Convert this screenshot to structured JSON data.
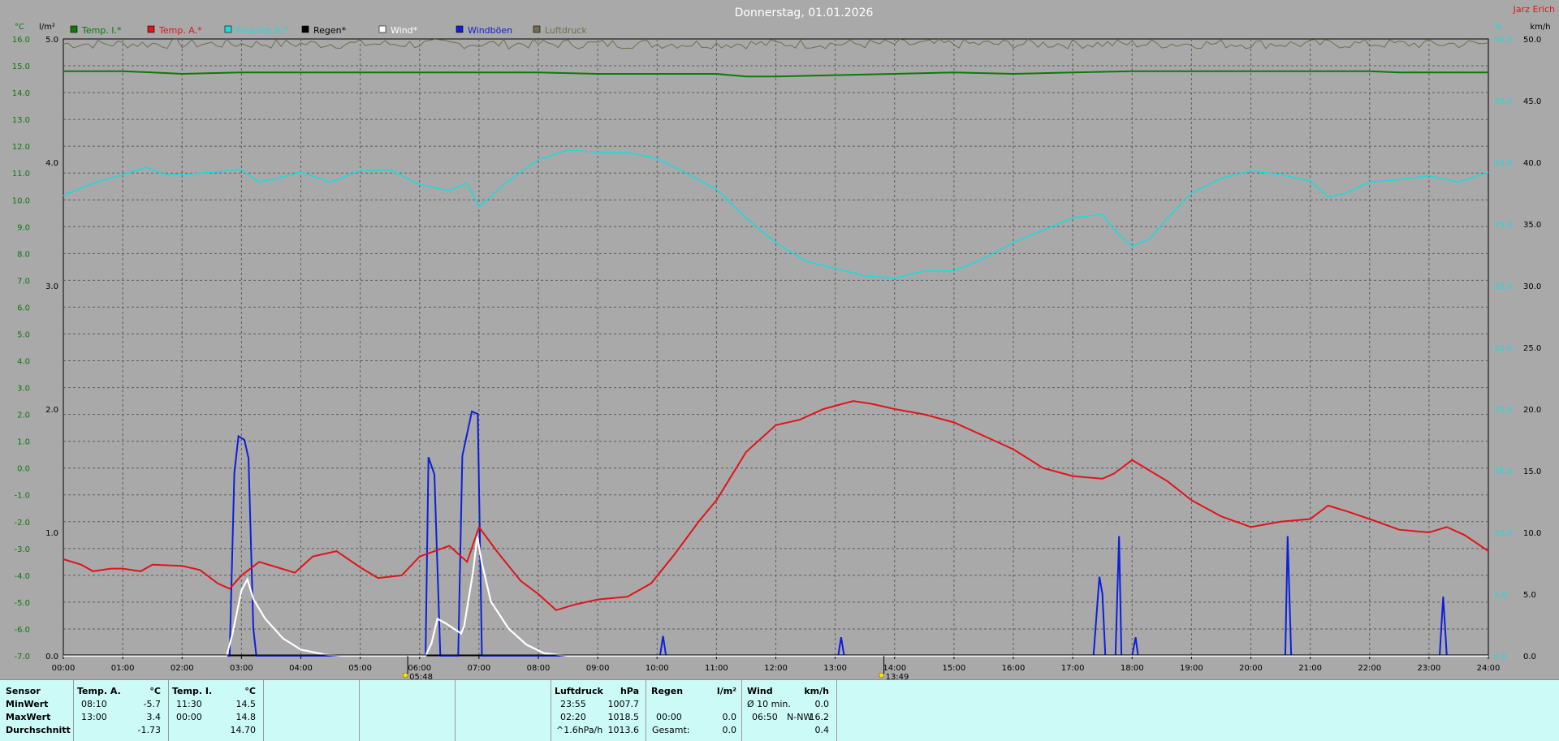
{
  "title": "Donnerstag, 01.01.2026",
  "author": "Jarz Erich",
  "colors": {
    "background": "#a9a9a9",
    "temp_inside": "#0a7a0a",
    "temp_outside": "#e0141a",
    "humidity": "#1fd9dc",
    "rain": "#000000",
    "wind": "#ffffff",
    "gusts": "#0c1fdc",
    "pressure": "#6f6f4e",
    "axis_right": "#1fd9dc",
    "footer_bg": "#ccfbf7"
  },
  "chart_data": {
    "type": "line",
    "axis_units": {
      "left_temp": "°C",
      "left_rain": "l/m²",
      "right_humidity": "%",
      "right_wind": "km/h"
    },
    "legend": [
      {
        "name": "Temp. I.*",
        "color": "#0a7a0a"
      },
      {
        "name": "Temp. A.*",
        "color": "#e0141a"
      },
      {
        "name": "Feuchte A.*",
        "color": "#1fd9dc"
      },
      {
        "name": "Regen*",
        "color": "#000000"
      },
      {
        "name": "Wind*",
        "color": "#ffffff"
      },
      {
        "name": "Windböen",
        "color": "#0c1fdc"
      },
      {
        "name": "Luftdruck",
        "color": "#6f6f4e"
      }
    ],
    "x_ticks": [
      "00:00",
      "01:00",
      "02:00",
      "03:00",
      "04:00",
      "05:00",
      "06:00",
      "07:00",
      "08:00",
      "09:00",
      "10:00",
      "11:00",
      "12:00",
      "13:00",
      "14:00",
      "15:00",
      "16:00",
      "17:00",
      "18:00",
      "19:00",
      "20:00",
      "21:00",
      "22:00",
      "23:00",
      "24:00"
    ],
    "temp_ticks": [
      "-7.0",
      "-6.0",
      "-5.0",
      "-4.0",
      "-3.0",
      "-2.0",
      "-1.0",
      "0.0",
      "1.0",
      "2.0",
      "3.0",
      "4.0",
      "5.0",
      "6.0",
      "7.0",
      "8.0",
      "9.0",
      "10.0",
      "11.0",
      "12.0",
      "13.0",
      "14.0",
      "15.0",
      "16.0"
    ],
    "rain_ticks": [
      "0.0",
      "1.0",
      "2.0",
      "3.0",
      "4.0",
      "5.0"
    ],
    "wind_ticks": [
      "0.0",
      "5.0",
      "10.0",
      "15.0",
      "20.0",
      "25.0",
      "30.0",
      "35.0",
      "40.0",
      "45.0",
      "50.0"
    ],
    "temp_range": [
      -7,
      16
    ],
    "rain_range": [
      0,
      5
    ],
    "wind_range": [
      0,
      50
    ],
    "sunrise": "05:48",
    "sunset": "13:49",
    "sunrise_hour": 5.8,
    "sunset_hour": 13.82,
    "temp_inside": [
      [
        0,
        14.8
      ],
      [
        1,
        14.8
      ],
      [
        1.5,
        14.75
      ],
      [
        2,
        14.7
      ],
      [
        3,
        14.75
      ],
      [
        4,
        14.75
      ],
      [
        5,
        14.75
      ],
      [
        6,
        14.75
      ],
      [
        7,
        14.75
      ],
      [
        8,
        14.75
      ],
      [
        9,
        14.7
      ],
      [
        10,
        14.7
      ],
      [
        11,
        14.7
      ],
      [
        11.5,
        14.6
      ],
      [
        12,
        14.6
      ],
      [
        13,
        14.65
      ],
      [
        14,
        14.7
      ],
      [
        15,
        14.75
      ],
      [
        16,
        14.7
      ],
      [
        17,
        14.75
      ],
      [
        18,
        14.8
      ],
      [
        19,
        14.8
      ],
      [
        20,
        14.8
      ],
      [
        21,
        14.8
      ],
      [
        22,
        14.8
      ],
      [
        22.5,
        14.75
      ],
      [
        23,
        14.75
      ],
      [
        24,
        14.75
      ]
    ],
    "temp_outside": [
      [
        0,
        -3.4
      ],
      [
        0.3,
        -3.6
      ],
      [
        0.5,
        -3.85
      ],
      [
        0.8,
        -3.75
      ],
      [
        1,
        -3.75
      ],
      [
        1.3,
        -3.85
      ],
      [
        1.5,
        -3.6
      ],
      [
        2,
        -3.65
      ],
      [
        2.3,
        -3.8
      ],
      [
        2.6,
        -4.3
      ],
      [
        2.8,
        -4.5
      ],
      [
        3,
        -4.0
      ],
      [
        3.3,
        -3.5
      ],
      [
        3.6,
        -3.7
      ],
      [
        3.9,
        -3.9
      ],
      [
        4.2,
        -3.3
      ],
      [
        4.6,
        -3.1
      ],
      [
        5,
        -3.7
      ],
      [
        5.3,
        -4.1
      ],
      [
        5.7,
        -4.0
      ],
      [
        6,
        -3.3
      ],
      [
        6.5,
        -2.9
      ],
      [
        6.8,
        -3.5
      ],
      [
        7,
        -2.2
      ],
      [
        7.3,
        -3.1
      ],
      [
        7.7,
        -4.2
      ],
      [
        8,
        -4.7
      ],
      [
        8.3,
        -5.3
      ],
      [
        8.6,
        -5.1
      ],
      [
        9,
        -4.9
      ],
      [
        9.5,
        -4.8
      ],
      [
        9.9,
        -4.3
      ],
      [
        10.3,
        -3.2
      ],
      [
        10.7,
        -2.0
      ],
      [
        11,
        -1.2
      ],
      [
        11.5,
        0.6
      ],
      [
        12,
        1.6
      ],
      [
        12.4,
        1.8
      ],
      [
        12.8,
        2.2
      ],
      [
        13.3,
        2.5
      ],
      [
        13.6,
        2.4
      ],
      [
        14,
        2.2
      ],
      [
        14.5,
        2.0
      ],
      [
        15,
        1.7
      ],
      [
        15.5,
        1.2
      ],
      [
        16,
        0.7
      ],
      [
        16.5,
        0.0
      ],
      [
        17,
        -0.3
      ],
      [
        17.5,
        -0.4
      ],
      [
        17.7,
        -0.2
      ],
      [
        18,
        0.3
      ],
      [
        18.3,
        -0.1
      ],
      [
        18.6,
        -0.5
      ],
      [
        19,
        -1.2
      ],
      [
        19.5,
        -1.8
      ],
      [
        20,
        -2.2
      ],
      [
        20.5,
        -2.0
      ],
      [
        21,
        -1.9
      ],
      [
        21.3,
        -1.4
      ],
      [
        21.6,
        -1.6
      ],
      [
        22,
        -1.9
      ],
      [
        22.5,
        -2.3
      ],
      [
        23,
        -2.4
      ],
      [
        23.3,
        -2.2
      ],
      [
        23.6,
        -2.5
      ],
      [
        24,
        -3.1
      ]
    ],
    "humidity": [
      [
        0,
        37.3
      ],
      [
        0.5,
        38.3
      ],
      [
        1,
        39.0
      ],
      [
        1.4,
        39.6
      ],
      [
        1.7,
        39.0
      ],
      [
        2,
        39.0
      ],
      [
        2.5,
        39.2
      ],
      [
        3,
        39.4
      ],
      [
        3.3,
        38.4
      ],
      [
        3.6,
        38.7
      ],
      [
        4,
        39.2
      ],
      [
        4.5,
        38.4
      ],
      [
        5,
        39.3
      ],
      [
        5.5,
        39.4
      ],
      [
        6,
        38.2
      ],
      [
        6.5,
        37.7
      ],
      [
        6.8,
        38.3
      ],
      [
        7,
        36.4
      ],
      [
        7.5,
        38.5
      ],
      [
        8,
        40.2
      ],
      [
        8.5,
        41.0
      ],
      [
        9,
        40.8
      ],
      [
        9.5,
        40.8
      ],
      [
        10,
        40.3
      ],
      [
        10.5,
        39.1
      ],
      [
        11,
        37.8
      ],
      [
        11.5,
        35.5
      ],
      [
        12,
        33.5
      ],
      [
        12.5,
        32.0
      ],
      [
        13,
        31.4
      ],
      [
        13.5,
        30.8
      ],
      [
        14,
        30.6
      ],
      [
        14.5,
        31.2
      ],
      [
        15,
        31.2
      ],
      [
        15.5,
        32.2
      ],
      [
        16,
        33.5
      ],
      [
        16.5,
        34.5
      ],
      [
        17,
        35.5
      ],
      [
        17.5,
        35.8
      ],
      [
        17.7,
        34.5
      ],
      [
        18,
        33.2
      ],
      [
        18.3,
        33.8
      ],
      [
        18.6,
        35.5
      ],
      [
        19,
        37.5
      ],
      [
        19.5,
        38.7
      ],
      [
        20,
        39.3
      ],
      [
        20.5,
        39.0
      ],
      [
        21,
        38.5
      ],
      [
        21.3,
        37.2
      ],
      [
        21.6,
        37.5
      ],
      [
        22,
        38.4
      ],
      [
        22.5,
        38.6
      ],
      [
        23,
        38.9
      ],
      [
        23.5,
        38.4
      ],
      [
        24,
        39.2
      ]
    ],
    "pressure_band": [
      49.2,
      50.0
    ],
    "wind": [
      [
        0,
        0
      ],
      [
        2.75,
        0
      ],
      [
        2.85,
        1.8
      ],
      [
        3.0,
        5.3
      ],
      [
        3.1,
        6.2
      ],
      [
        3.2,
        4.6
      ],
      [
        3.4,
        3.0
      ],
      [
        3.7,
        1.4
      ],
      [
        4,
        0.5
      ],
      [
        4.4,
        0.1
      ],
      [
        4.7,
        0
      ],
      [
        6.1,
        0
      ],
      [
        6.2,
        1.0
      ],
      [
        6.3,
        3.0
      ],
      [
        6.45,
        2.6
      ],
      [
        6.7,
        1.8
      ],
      [
        6.75,
        2.4
      ],
      [
        6.9,
        6.8
      ],
      [
        6.97,
        9.7
      ],
      [
        7.05,
        7.5
      ],
      [
        7.2,
        4.4
      ],
      [
        7.5,
        2.2
      ],
      [
        7.8,
        0.9
      ],
      [
        8.1,
        0.2
      ],
      [
        8.5,
        0
      ],
      [
        24,
        0
      ]
    ],
    "gusts": [
      [
        0,
        0
      ],
      [
        2.8,
        0
      ],
      [
        2.88,
        14.8
      ],
      [
        2.95,
        17.8
      ],
      [
        3.05,
        17.5
      ],
      [
        3.12,
        16.0
      ],
      [
        3.2,
        2.2
      ],
      [
        3.25,
        0
      ],
      [
        6.1,
        0
      ],
      [
        6.15,
        16.1
      ],
      [
        6.25,
        14.7
      ],
      [
        6.35,
        0
      ],
      [
        6.65,
        0
      ],
      [
        6.72,
        16.2
      ],
      [
        6.88,
        19.8
      ],
      [
        6.98,
        19.6
      ],
      [
        7.05,
        0
      ],
      [
        10.05,
        0
      ],
      [
        10.1,
        1.6
      ],
      [
        10.15,
        0
      ],
      [
        13.05,
        0
      ],
      [
        13.1,
        1.5
      ],
      [
        13.15,
        0
      ],
      [
        17.35,
        0
      ],
      [
        17.45,
        6.4
      ],
      [
        17.5,
        5.0
      ],
      [
        17.55,
        0
      ],
      [
        17.72,
        0
      ],
      [
        17.78,
        9.7
      ],
      [
        17.82,
        0
      ],
      [
        18.0,
        0
      ],
      [
        18.06,
        1.5
      ],
      [
        18.1,
        0
      ],
      [
        20.58,
        0
      ],
      [
        20.62,
        9.7
      ],
      [
        20.68,
        0
      ],
      [
        23.18,
        0
      ],
      [
        23.24,
        4.8
      ],
      [
        23.3,
        0
      ],
      [
        24,
        0
      ]
    ]
  },
  "footer": {
    "sensor": {
      "title": "Sensor",
      "rows": [
        "MinWert",
        "MaxWert",
        "Durchschnitt"
      ]
    },
    "temp_a": {
      "title": "Temp. A.",
      "unit": "°C",
      "min_time": "08:10",
      "min_value": "-5.7",
      "max_time": "13:00",
      "max_value": "3.4",
      "avg": "-1.73"
    },
    "temp_i": {
      "title": "Temp. I.",
      "unit": "°C",
      "min_time": "11:30",
      "min_value": "14.5",
      "max_time": "00:00",
      "max_value": "14.8",
      "avg": "14.70"
    },
    "pressure": {
      "title": "Luftdruck",
      "unit": "hPa",
      "min_time": "23:55",
      "min_value": "1007.7",
      "max_time": "02:20",
      "max_value": "1018.5",
      "trend_label": "^1.6hPa/h",
      "trend_value": "1013.6"
    },
    "rain": {
      "title": "Regen",
      "unit": "l/m²",
      "max_time": "00:00",
      "max_value": "0.0",
      "total_label": "Gesamt:",
      "total_value": "0.0"
    },
    "wind": {
      "title": "Wind",
      "unit": "km/h",
      "avg_label": "Ø 10 min.",
      "avg_value": "0.0",
      "max_time": "06:50",
      "max_dir": "N-NW",
      "max_value": "16.2",
      "mean_value": "0.4"
    }
  }
}
